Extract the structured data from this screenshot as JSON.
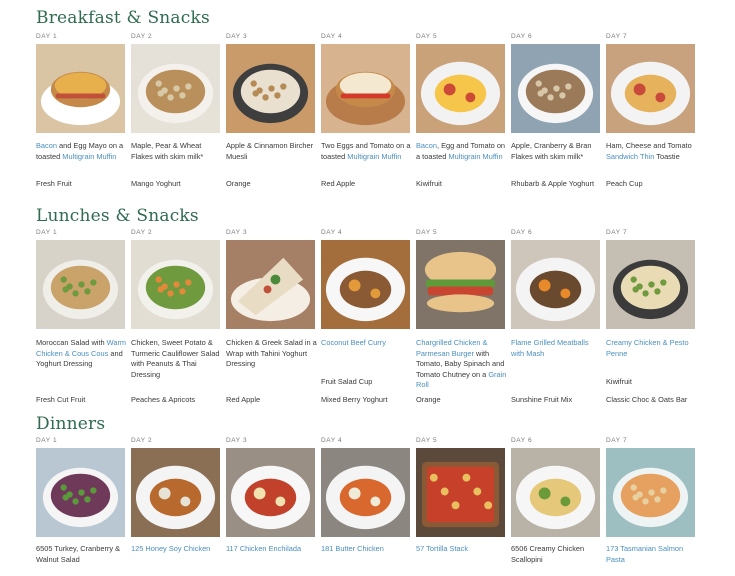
{
  "sections": [
    {
      "title": "Breakfast & Snacks",
      "days": [
        {
          "day": "DAY 1",
          "meal": [
            {
              "t": "Bacon",
              "link": true
            },
            {
              "t": " and Egg Mayo on a toasted "
            },
            {
              "t": "Multigrain Muffin",
              "link": true
            }
          ],
          "extra": [
            "Fresh Fruit"
          ]
        },
        {
          "day": "DAY 2",
          "meal": [
            {
              "t": "Maple, Pear & Wheat Flakes with skim milk*"
            }
          ],
          "extra": [
            "Mango Yoghurt"
          ]
        },
        {
          "day": "DAY 3",
          "meal": [
            {
              "t": "Apple & Cinnamon Bircher Muesli"
            }
          ],
          "extra": [
            "Orange"
          ]
        },
        {
          "day": "DAY 4",
          "meal": [
            {
              "t": "Two Eggs and Tomato on a toasted "
            },
            {
              "t": "Multigrain Muffin",
              "link": true
            }
          ],
          "extra": [
            "Red Apple"
          ]
        },
        {
          "day": "DAY 5",
          "meal": [
            {
              "t": "Bacon",
              "link": true
            },
            {
              "t": ", Egg and Tomato on a toasted "
            },
            {
              "t": "Multigrain Muffin",
              "link": true
            }
          ],
          "extra": [
            "Kiwifruit"
          ]
        },
        {
          "day": "DAY 6",
          "meal": [
            {
              "t": "Apple, Cranberry & Bran Flakes with skim milk*"
            }
          ],
          "extra": [
            "Rhubarb & Apple Yoghurt"
          ]
        },
        {
          "day": "DAY 7",
          "meal": [
            {
              "t": "Ham, Cheese and Tomato "
            },
            {
              "t": "Sandwich Thin",
              "link": true
            },
            {
              "t": " Toastie"
            }
          ],
          "extra": [
            "Peach Cup"
          ]
        }
      ]
    },
    {
      "title": "Lunches & Snacks",
      "days": [
        {
          "day": "DAY 1",
          "meal": [
            {
              "t": "Moroccan Salad with "
            },
            {
              "t": "Warm Chicken & Cous Cous",
              "link": true
            },
            {
              "t": " and Yoghurt Dressing"
            }
          ],
          "extra": [
            "Fresh Cut Fruit"
          ]
        },
        {
          "day": "DAY 2",
          "meal": [
            {
              "t": "Chicken, Sweet Potato & Turmeric Cauliflower Salad with Peanuts & Thai Dressing"
            }
          ],
          "extra": [
            "Peaches & Apricots"
          ]
        },
        {
          "day": "DAY 3",
          "meal": [
            {
              "t": "Chicken & Greek Salad in a Wrap with Tahini Yoghurt Dressing"
            }
          ],
          "extra": [
            "Red Apple"
          ]
        },
        {
          "day": "DAY 4",
          "meal": [
            {
              "t": "Coconut Beef Curry",
              "link": true
            }
          ],
          "extra": [
            "Fruit Salad Cup",
            "Mixed Berry Yoghurt"
          ]
        },
        {
          "day": "DAY 5",
          "meal": [
            {
              "t": "Chargrilled Chicken & Parmesan Burger",
              "link": true
            },
            {
              "t": " with Tomato, Baby Spinach and Tomato Chutney on a "
            },
            {
              "t": "Grain Roll",
              "link": true
            }
          ],
          "extra": [
            "Orange"
          ]
        },
        {
          "day": "DAY 6",
          "meal": [
            {
              "t": "Flame Grilled Meatballs with Mash",
              "link": true
            }
          ],
          "extra": [
            "Sunshine Fruit Mix"
          ]
        },
        {
          "day": "DAY 7",
          "meal": [
            {
              "t": "Creamy Chicken & Pesto Penne",
              "link": true
            }
          ],
          "extra": [
            "Kiwifruit",
            "Classic Choc & Oats Bar"
          ]
        }
      ]
    },
    {
      "title": "Dinners",
      "days": [
        {
          "day": "DAY 1",
          "meal": [
            {
              "t": "6505 Turkey, Cranberry & Walnut Salad"
            }
          ],
          "extra": []
        },
        {
          "day": "DAY 2",
          "meal": [
            {
              "t": "125 Honey Soy Chicken",
              "link": true
            }
          ],
          "extra": []
        },
        {
          "day": "DAY 3",
          "meal": [
            {
              "t": "117 Chicken Enchilada",
              "link": true
            }
          ],
          "extra": []
        },
        {
          "day": "DAY 4",
          "meal": [
            {
              "t": "181 Butter Chicken",
              "link": true
            }
          ],
          "extra": []
        },
        {
          "day": "DAY 5",
          "meal": [
            {
              "t": "57 Tortilla Stack",
              "link": true
            }
          ],
          "extra": []
        },
        {
          "day": "DAY 6",
          "meal": [
            {
              "t": "6506 Creamy Chicken Scallopini"
            }
          ],
          "extra": []
        },
        {
          "day": "DAY 7",
          "meal": [
            {
              "t": "173 Tasmanian Salmon Pasta",
              "link": true
            }
          ],
          "extra": []
        }
      ]
    }
  ],
  "photos": [
    [
      {
        "bg": "#d9c4a3",
        "dish": "#ffffff",
        "food": "#e8b04d",
        "accent": "#c0503a",
        "shape": "muffin"
      },
      {
        "bg": "#e6e1d8",
        "dish": "#f4f1ec",
        "food": "#b9905c",
        "accent": "#d8c9a6",
        "shape": "bowl"
      },
      {
        "bg": "#c99b6a",
        "dish": "#3e3e3e",
        "food": "#e9e0cf",
        "accent": "#b58a55",
        "shape": "bowl"
      },
      {
        "bg": "#d7b48f",
        "dish": "#b87c4a",
        "food": "#f4e9d0",
        "accent": "#d33a2a",
        "shape": "muffin"
      },
      {
        "bg": "#caa27a",
        "dish": "#f2f2f2",
        "food": "#f6c64a",
        "accent": "#cc4a36",
        "shape": "plate"
      },
      {
        "bg": "#8fa3b2",
        "dish": "#f6f6f6",
        "food": "#9a7a58",
        "accent": "#d8c6a8",
        "shape": "bowl"
      },
      {
        "bg": "#c8a27e",
        "dish": "#f3f3f3",
        "food": "#e6b25c",
        "accent": "#c94a3a",
        "shape": "plate"
      }
    ],
    [
      {
        "bg": "#d8d3c9",
        "dish": "#f0eee8",
        "food": "#c9a36a",
        "accent": "#6f9a3e",
        "shape": "bowl"
      },
      {
        "bg": "#e1ddd3",
        "dish": "#f3f1ec",
        "food": "#6f9a3e",
        "accent": "#e28a3a",
        "shape": "bowl"
      },
      {
        "bg": "#a58066",
        "dish": "#f5eee4",
        "food": "#e9dcc5",
        "accent": "#4b8a3a",
        "shape": "wrap"
      },
      {
        "bg": "#a46d3c",
        "dish": "#f7f7f7",
        "food": "#8a5a34",
        "accent": "#e39a3a",
        "shape": "plate"
      },
      {
        "bg": "#7f7467",
        "dish": "#e8c38a",
        "food": "#c9452f",
        "accent": "#5f9a3a",
        "shape": "burger"
      },
      {
        "bg": "#cfc6bb",
        "dish": "#f4f4f4",
        "food": "#6a4a2e",
        "accent": "#e88a2a",
        "shape": "plate"
      },
      {
        "bg": "#c5beb2",
        "dish": "#3b3b3b",
        "food": "#e9dcb5",
        "accent": "#6f9a3e",
        "shape": "bowl"
      }
    ],
    [
      {
        "bg": "#b8c7d2",
        "dish": "#f5f5f5",
        "food": "#6f3a5a",
        "accent": "#5b9a3a",
        "shape": "bowl"
      },
      {
        "bg": "#8b6f55",
        "dish": "#f4f4f4",
        "food": "#b86a2e",
        "accent": "#e6e2d6",
        "shape": "plate"
      },
      {
        "bg": "#9a8f84",
        "dish": "#f7f7f7",
        "food": "#c2412a",
        "accent": "#f2e2b0",
        "shape": "plate"
      },
      {
        "bg": "#8c8680",
        "dish": "#f4f4f4",
        "food": "#d9682e",
        "accent": "#f0ead8",
        "shape": "plate"
      },
      {
        "bg": "#5b4a3b",
        "dish": "#8a5a36",
        "food": "#c6402a",
        "accent": "#e8c060",
        "shape": "tray"
      },
      {
        "bg": "#b9b2a6",
        "dish": "#f6f6f6",
        "food": "#e6c87a",
        "accent": "#6a9a3a",
        "shape": "plate"
      },
      {
        "bg": "#9dbfc2",
        "dish": "#eef3f3",
        "food": "#e6a060",
        "accent": "#e7d1a0",
        "shape": "bowl"
      }
    ]
  ]
}
